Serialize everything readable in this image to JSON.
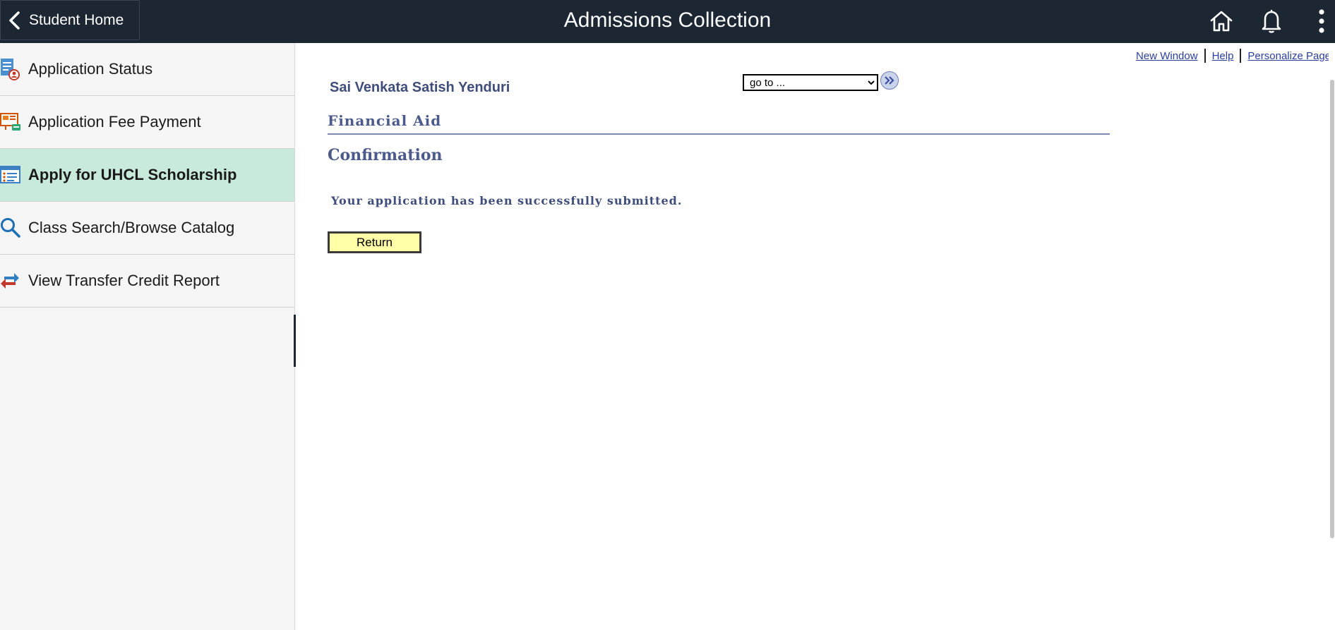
{
  "header": {
    "back_label": "Student Home",
    "title": "Admissions Collection",
    "icons": [
      "chevron-left-icon",
      "home-icon",
      "bell-icon",
      "more-vertical-icon"
    ]
  },
  "sidebar": {
    "items": [
      {
        "label": "Application Status",
        "icon": "application-status-icon",
        "active": false
      },
      {
        "label": "Application Fee Payment",
        "icon": "fee-payment-icon",
        "active": false
      },
      {
        "label": "Apply for UHCL Scholarship",
        "icon": "scholarship-form-icon",
        "active": true
      },
      {
        "label": "Class Search/Browse Catalog",
        "icon": "search-icon",
        "active": false
      },
      {
        "label": "View Transfer Credit Report",
        "icon": "transfer-arrows-icon",
        "active": false
      }
    ]
  },
  "content": {
    "links": {
      "new_window": "New Window",
      "help": "Help",
      "personalize": "Personalize Page"
    },
    "student_name": "Sai Venkata Satish Yenduri",
    "goto_selected": "go to ...",
    "section_title": "Financial Aid",
    "page_heading": "Confirmation",
    "message": "Your application has been successfully submitted.",
    "return_label": "Return"
  },
  "colors": {
    "header_bg": "#1d2633",
    "active_item_bg": "#c8eadb",
    "heading_color": "#4b5a8a",
    "return_button_bg": "#ffffa8",
    "link_color": "#2a3e9e"
  }
}
